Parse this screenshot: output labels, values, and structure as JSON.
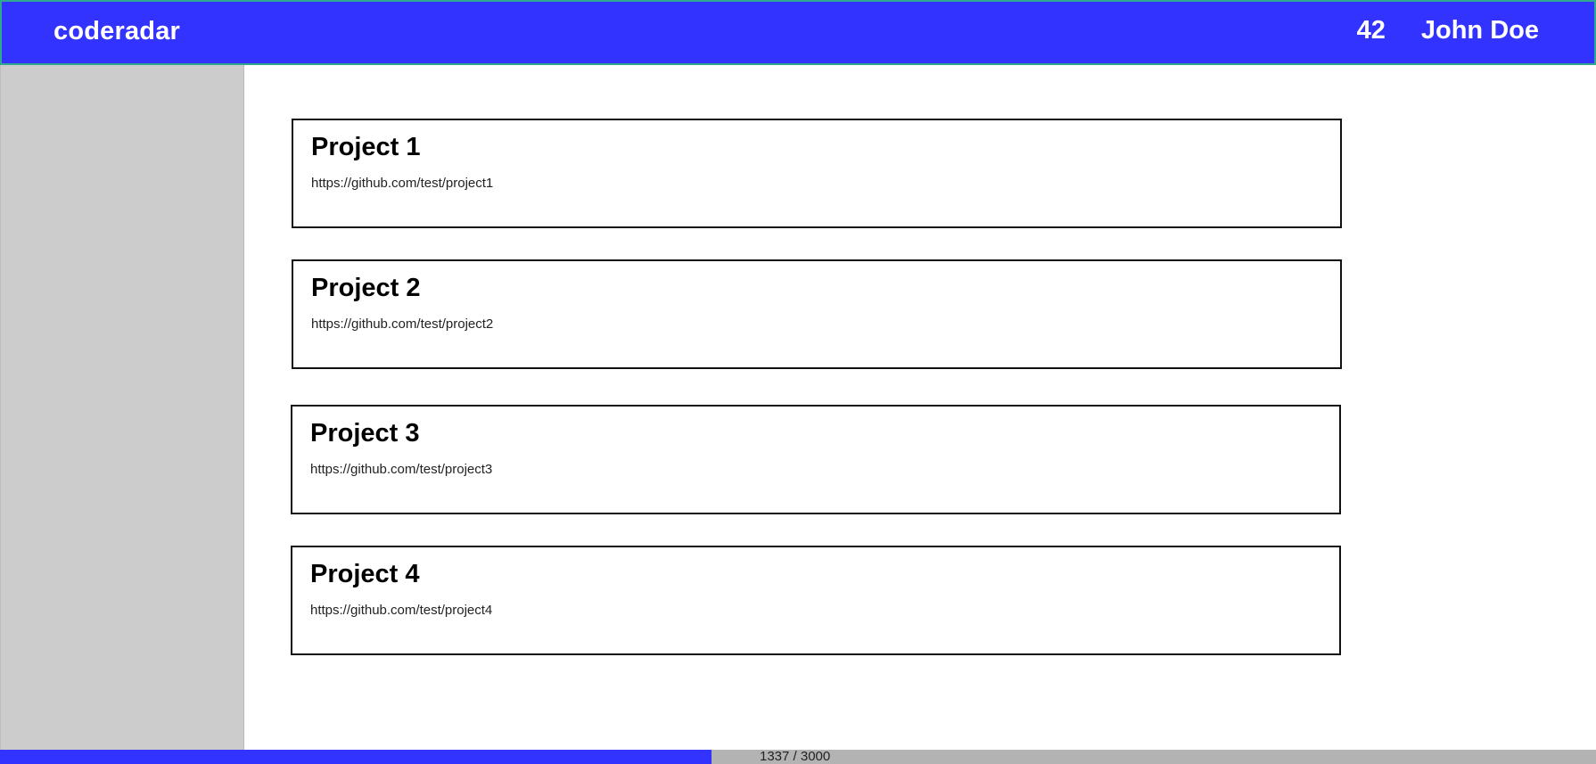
{
  "header": {
    "brand": "coderadar",
    "points": "42",
    "username": "John Doe"
  },
  "colors": {
    "header_bg": "#3333ff",
    "sidebar_bg": "#cccccc",
    "progress_fill": "#3333ff",
    "progress_track": "#b3b3b3"
  },
  "projects": [
    {
      "name": "Project 1",
      "url": "https://github.com/test/project1"
    },
    {
      "name": "Project 2",
      "url": "https://github.com/test/project2"
    },
    {
      "name": "Project 3",
      "url": "https://github.com/test/project3"
    },
    {
      "name": "Project 4",
      "url": "https://github.com/test/project4"
    }
  ],
  "progress": {
    "label": "1337 / 3000",
    "current": 1337,
    "total": 3000
  }
}
